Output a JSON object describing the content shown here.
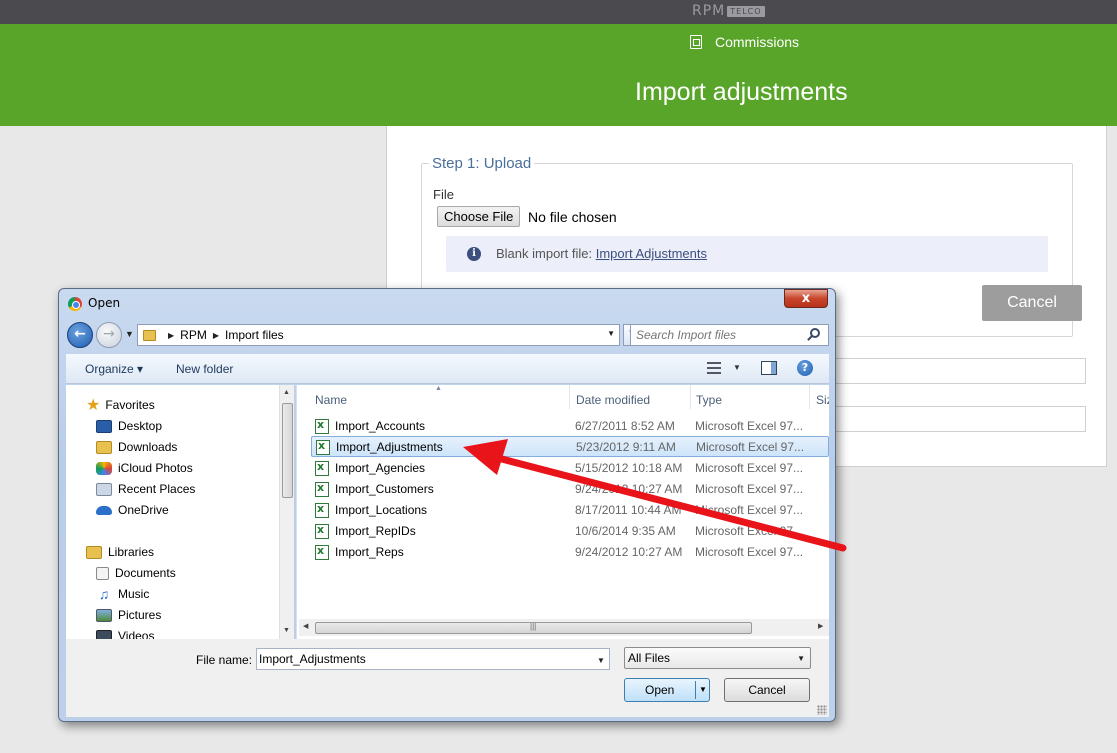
{
  "header": {
    "logo_text": "RPM",
    "logo_sub": "TELCO"
  },
  "breadcrumb": {
    "label": "Commissions"
  },
  "page": {
    "title": "Import adjustments"
  },
  "upload": {
    "legend": "Step 1: Upload",
    "file_label": "File",
    "choose_button": "Choose File",
    "no_file_text": "No file chosen",
    "info_prefix": "Blank import file:",
    "info_link": "Import Adjustments",
    "cancel_button": "Cancel"
  },
  "dialog": {
    "title": "Open",
    "close": "x",
    "address": {
      "segments": [
        "RPM",
        "Import files"
      ]
    },
    "search_placeholder": "Search Import files",
    "toolbar": {
      "organize": "Organize ▾",
      "new_folder": "New folder",
      "help": "?"
    },
    "nav": {
      "favorites_header": "Favorites",
      "favorites": [
        "Desktop",
        "Downloads",
        "iCloud Photos",
        "Recent Places",
        "OneDrive"
      ],
      "libraries_header": "Libraries",
      "libraries": [
        "Documents",
        "Music",
        "Pictures",
        "Videos"
      ]
    },
    "columns": {
      "name": "Name",
      "date": "Date modified",
      "type": "Type",
      "size": "Siz"
    },
    "files": [
      {
        "name": "Import_Accounts",
        "date": "6/27/2011 8:52 AM",
        "type": "Microsoft Excel 97..."
      },
      {
        "name": "Import_Adjustments",
        "date": "5/23/2012 9:11 AM",
        "type": "Microsoft Excel 97..."
      },
      {
        "name": "Import_Agencies",
        "date": "5/15/2012 10:18 AM",
        "type": "Microsoft Excel 97..."
      },
      {
        "name": "Import_Customers",
        "date": "9/24/2012 10:27 AM",
        "type": "Microsoft Excel 97..."
      },
      {
        "name": "Import_Locations",
        "date": "8/17/2011 10:44 AM",
        "type": "Microsoft Excel 97..."
      },
      {
        "name": "Import_RepIDs",
        "date": "10/6/2014 9:35 AM",
        "type": "Microsoft Excel 97..."
      },
      {
        "name": "Import_Reps",
        "date": "9/24/2012 10:27 AM",
        "type": "Microsoft Excel 97..."
      }
    ],
    "selected_file": "Import_Adjustments",
    "file_name_label": "File name:",
    "file_name_value": "Import_Adjustments",
    "file_type": "All Files",
    "open_button": "Open",
    "cancel_button": "Cancel"
  },
  "colors": {
    "green_band": "#58a52a",
    "annotation_arrow": "#e8141a",
    "selection": "#cde4fa"
  }
}
